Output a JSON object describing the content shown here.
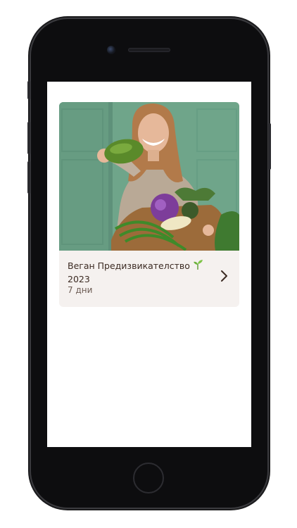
{
  "card": {
    "title": "Веган Предизвикателство",
    "title_icon": "seedling-icon",
    "year": "2023",
    "duration": "7 дни",
    "image": "woman-holding-vegetable-basket-photo",
    "chevron_icon": "chevron-right-icon"
  },
  "colors": {
    "card_background": "#f5f1ef",
    "title_text": "#3b2a22",
    "subtitle_text": "#6b5a52",
    "photo_wall": "#6fa58a"
  }
}
